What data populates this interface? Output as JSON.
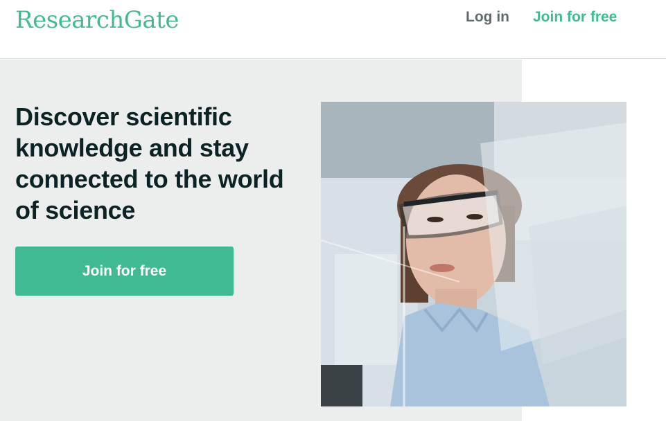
{
  "header": {
    "logo_text": "ResearchGate",
    "login_label": "Log in",
    "join_label": "Join for free"
  },
  "hero": {
    "headline": "Discover scientific knowledge and stay connected to the world of science",
    "cta_label": "Join for free",
    "image_description_icon": "scientist-photo"
  },
  "colors": {
    "brand": "#40ba95",
    "headline": "#0c2224",
    "nav_text": "#5f6b6e",
    "hero_background": "#ebeeed"
  }
}
